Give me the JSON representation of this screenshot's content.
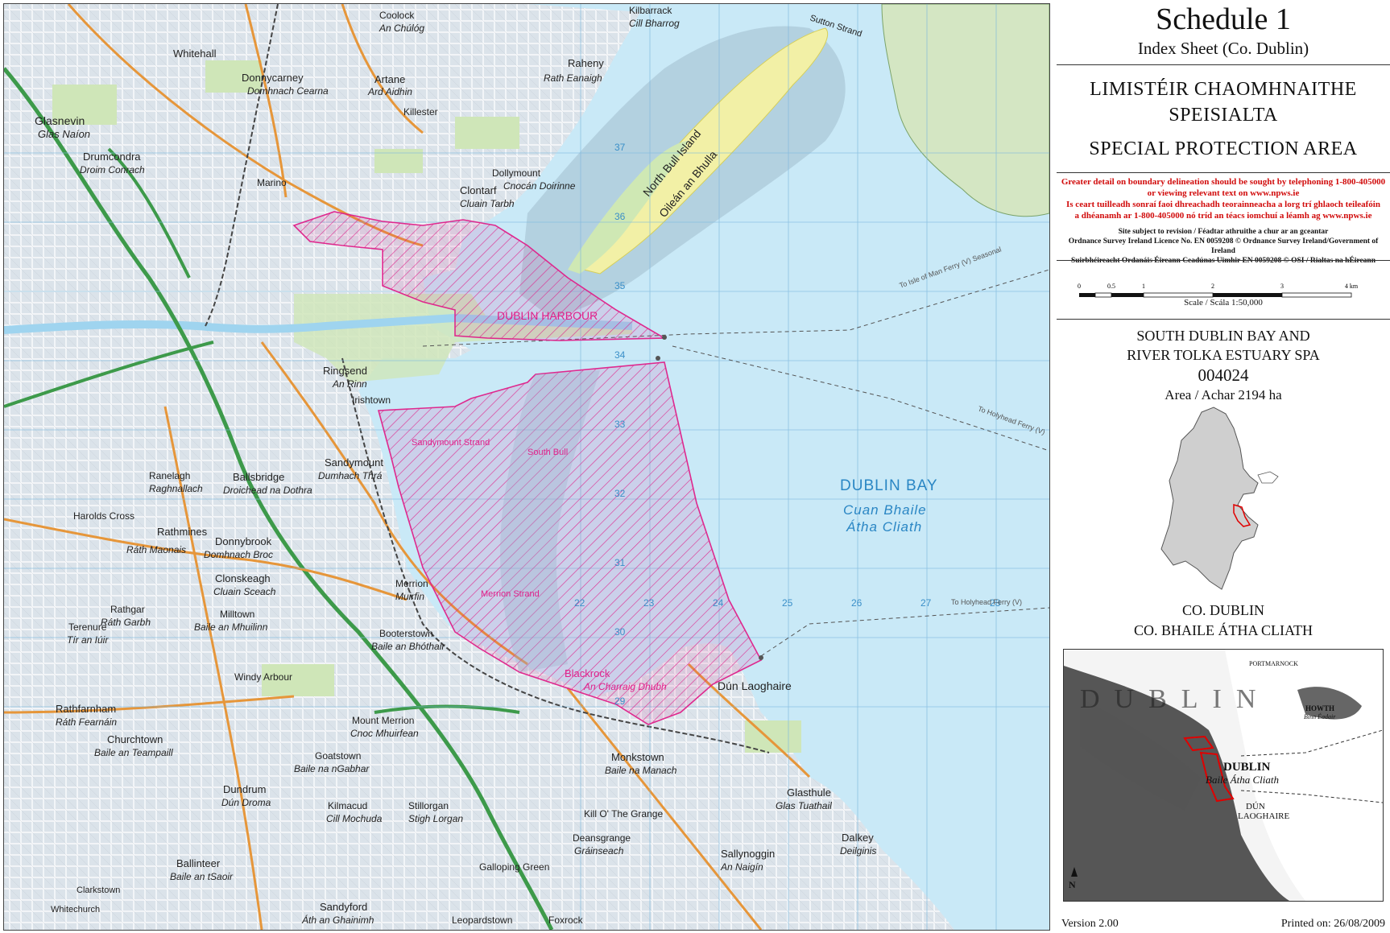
{
  "sidebar": {
    "title": "Schedule 1",
    "subtitle": "Index Sheet (Co. Dublin)",
    "irish_heading_line1": "LIMISTÉIR CHAOMHNAITHE",
    "irish_heading_line2": "SPEISIALTA",
    "english_heading": "SPECIAL PROTECTION AREA",
    "notice_en_line1": "Greater detail on boundary delineation should be sought by telephoning 1-800-405000",
    "notice_en_line2": "or viewing relevant text on www.npws.ie",
    "notice_ga_line1": "Is ceart tuilleadh sonraí faoi dhreachadh teorainneacha a lorg trí ghlaoch teileafóin",
    "notice_ga_line2": "a dhéanamh ar 1-800-405000 nó tríd an téacs iomchuí a léamh ag www.npws.ie",
    "revision_note": "Site subject to revision / Féadtar athruithe a chur ar an gceantar",
    "licence_line1": "Ordnance Survey Ireland Licence No. EN 0059208 © Ordnance Survey Ireland/Government of Ireland",
    "licence_line2": "Suirbhéireacht Ordanáis Éireann Ceadúnas Uimhir EN 0059208 © OSI / Rialtas na hÉireann",
    "scale_ticks": [
      "0",
      "0.5",
      "1",
      "2",
      "3",
      "4 km"
    ],
    "scale_label": "Scale / Scála 1:50,000",
    "site_name_line1": "SOUTH DUBLIN BAY AND",
    "site_name_line2": "RIVER TOLKA ESTUARY SPA",
    "site_code": "004024",
    "area_text": "Area / Achar 2194 ha",
    "county_en": "CO. DUBLIN",
    "county_ga": "CO. BHAILE ÁTHA CLIATH",
    "version": "Version 2.00",
    "printed": "Printed on: 26/08/2009"
  },
  "inset": {
    "dublin": "DUBLIN",
    "dublin_big": "DUBLIN",
    "dublin_irish": "Baile Átha Cliath",
    "dun_laoghaire": "DÚN",
    "dun_laoghaire2": "LAOGHAIRE",
    "howth": "HOWTH",
    "howth_irish": "Binn Éadair",
    "portmarnock": "PORTMARNOCK",
    "north_arrow": "N"
  },
  "map": {
    "place_labels": [
      {
        "id": "whitehall",
        "text": "Whitehall"
      },
      {
        "id": "donnycarney",
        "text": "Donnycarney"
      },
      {
        "id": "donnycarney-ga",
        "text": "Domhnach Cearna"
      },
      {
        "id": "glasnevin",
        "text": "Glasnevin"
      },
      {
        "id": "glasnevin-ga",
        "text": "Glas Naíon"
      },
      {
        "id": "drumcondra",
        "text": "Drumcondra"
      },
      {
        "id": "drumcondra-ga",
        "text": "Droim Conrach"
      },
      {
        "id": "artane",
        "text": "Artane"
      },
      {
        "id": "artane-ga",
        "text": "Ard Aidhin"
      },
      {
        "id": "killester",
        "text": "Killester"
      },
      {
        "id": "raheny",
        "text": "Raheny"
      },
      {
        "id": "raheny-ga",
        "text": "Rath Eanaigh"
      },
      {
        "id": "coolock",
        "text": "Coolock"
      },
      {
        "id": "coolock-ga",
        "text": "An Chúlóg"
      },
      {
        "id": "kilbarrack",
        "text": "Kilbarrack"
      },
      {
        "id": "kilbarrack-ga",
        "text": "Cill Bharrog"
      },
      {
        "id": "marino",
        "text": "Marino"
      },
      {
        "id": "clontarf",
        "text": "Clontarf"
      },
      {
        "id": "clontarf-ga",
        "text": "Cluain Tarbh"
      },
      {
        "id": "dollymount",
        "text": "Dollymount"
      },
      {
        "id": "dollymount-ga",
        "text": "Cnocán Doirinne"
      },
      {
        "id": "ringsend",
        "text": "Ringsend"
      },
      {
        "id": "ringsend-ga",
        "text": "An Rinn"
      },
      {
        "id": "irishtown",
        "text": "Irishtown"
      },
      {
        "id": "sandymount",
        "text": "Sandymount"
      },
      {
        "id": "sandymount-ga",
        "text": "Dumhach Thrá"
      },
      {
        "id": "ranelagh",
        "text": "Ranelagh"
      },
      {
        "id": "ranelagh-ga",
        "text": "Raghnallach"
      },
      {
        "id": "ballsbridge",
        "text": "Ballsbridge"
      },
      {
        "id": "ballsbridge-ga",
        "text": "Droichead na Dothra"
      },
      {
        "id": "harolds-cross",
        "text": "Harolds Cross"
      },
      {
        "id": "rathmines",
        "text": "Rathmines"
      },
      {
        "id": "rathmines-ga",
        "text": "Ráth Maonais"
      },
      {
        "id": "donnybrook",
        "text": "Donnybrook"
      },
      {
        "id": "donnybrook-ga",
        "text": "Domhnach Broc"
      },
      {
        "id": "clonskeagh",
        "text": "Clonskeagh"
      },
      {
        "id": "clonskeagh-ga",
        "text": "Cluain Sceach"
      },
      {
        "id": "milltown",
        "text": "Milltown"
      },
      {
        "id": "milltown-ga",
        "text": "Baile an Mhuilinn"
      },
      {
        "id": "rathgar",
        "text": "Rathgar"
      },
      {
        "id": "rathgar-ga",
        "text": "Ráth Garbh"
      },
      {
        "id": "terenure",
        "text": "Terenure"
      },
      {
        "id": "terenure-ga",
        "text": "Tír an Iúir"
      },
      {
        "id": "booterstown",
        "text": "Booterstown"
      },
      {
        "id": "booterstown-ga",
        "text": "Baile an Bhóthair"
      },
      {
        "id": "merrion",
        "text": "Merrion"
      },
      {
        "id": "merrion-ga",
        "text": "Muirfin"
      },
      {
        "id": "windy-arbour",
        "text": "Windy Arbour"
      },
      {
        "id": "rathfarnham",
        "text": "Rathfarnham"
      },
      {
        "id": "rathfarnham-ga",
        "text": "Ráth Fearnáin"
      },
      {
        "id": "churchtown",
        "text": "Churchtown"
      },
      {
        "id": "churchtown-ga",
        "text": "Baile an Teampaill"
      },
      {
        "id": "mount-merrion",
        "text": "Mount Merrion"
      },
      {
        "id": "mount-merrion-ga",
        "text": "Cnoc Mhuirfean"
      },
      {
        "id": "goatstown",
        "text": "Goatstown"
      },
      {
        "id": "goatstown-ga",
        "text": "Baile na nGabhar"
      },
      {
        "id": "dundrum",
        "text": "Dundrum"
      },
      {
        "id": "dundrum-ga",
        "text": "Dún Droma"
      },
      {
        "id": "kilmacud",
        "text": "Kilmacud"
      },
      {
        "id": "kilmacud-ga",
        "text": "Cill Mochuda"
      },
      {
        "id": "stillorgan",
        "text": "Stillorgan"
      },
      {
        "id": "stillorgan-ga",
        "text": "Stigh Lorgan"
      },
      {
        "id": "monkstown",
        "text": "Monkstown"
      },
      {
        "id": "monkstown-ga",
        "text": "Baile na Manach"
      },
      {
        "id": "kill-o-the-grange",
        "text": "Kill O' The Grange"
      },
      {
        "id": "deansgrange",
        "text": "Deansgrange"
      },
      {
        "id": "deansgrange-ga",
        "text": "Gráinseach"
      },
      {
        "id": "blackrock",
        "text": "Blackrock"
      },
      {
        "id": "blackrock-ga",
        "text": "An Charraig Dhubh"
      },
      {
        "id": "dun-laoghaire",
        "text": "Dún Laoghaire"
      },
      {
        "id": "glasthule",
        "text": "Glasthule"
      },
      {
        "id": "glasthule-ga",
        "text": "Glas Tuathail"
      },
      {
        "id": "dalkey",
        "text": "Dalkey"
      },
      {
        "id": "dalkey-ga",
        "text": "Deilginis"
      },
      {
        "id": "sallynoggin",
        "text": "Sallynoggin"
      },
      {
        "id": "sallynoggin-ga",
        "text": "An Naigín"
      },
      {
        "id": "ballinteer",
        "text": "Ballinteer"
      },
      {
        "id": "ballinteer-ga",
        "text": "Baile an tSaoir"
      },
      {
        "id": "sandyford",
        "text": "Sandyford"
      },
      {
        "id": "sandyford-ga",
        "text": "Áth an Ghainimh"
      },
      {
        "id": "foxrock",
        "text": "Foxrock"
      },
      {
        "id": "leopardstown",
        "text": "Leopardstown"
      },
      {
        "id": "galloping-green",
        "text": "Galloping Green"
      },
      {
        "id": "clarkstown",
        "text": "Clarkstown"
      },
      {
        "id": "whitechurch",
        "text": "Whitechurch"
      },
      {
        "id": "dublin-harbour",
        "text": "DUBLIN HARBOUR"
      },
      {
        "id": "north-bull-island",
        "text": "North Bull Island"
      },
      {
        "id": "oilean-an-bhulla",
        "text": "Oileán an Bhulla"
      },
      {
        "id": "south-bull",
        "text": "South Bull"
      },
      {
        "id": "sandymount-strand",
        "text": "Sandymount Strand"
      },
      {
        "id": "merrion-strand",
        "text": "Merrion Strand"
      },
      {
        "id": "sutton-strand",
        "text": "Sutton Strand"
      }
    ],
    "bay_name": "DUBLIN BAY",
    "bay_name_irish1": "Cuan Bhaile",
    "bay_name_irish2": "Átha Cliath",
    "ferry_labels": [
      {
        "id": "ferry-isle-of-man",
        "text": "To Isle of Man Ferry (V) Seasonal"
      },
      {
        "id": "ferry-holyhead",
        "text": "To Holyhead Ferry (V)"
      },
      {
        "id": "ferry-holyhead-2",
        "text": "To Holyhead Ferry (V)"
      }
    ],
    "grid_eastings": [
      "22",
      "23",
      "24",
      "25",
      "26",
      "27",
      "28"
    ],
    "grid_northings": [
      "37",
      "36",
      "35",
      "34",
      "33",
      "32",
      "31",
      "30",
      "29"
    ],
    "spa_color": "#e0208a",
    "sea_color": "#c9e9f7",
    "land_color": "#dfe7ee"
  }
}
